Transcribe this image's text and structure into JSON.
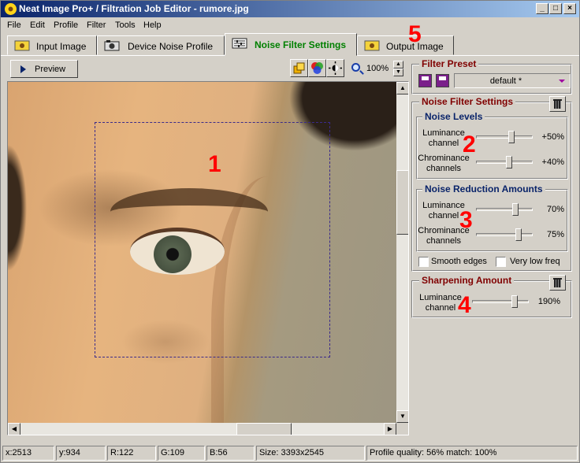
{
  "window": {
    "title": "Neat Image Pro+ / Filtration Job Editor - rumore.jpg"
  },
  "menu": [
    "File",
    "Edit",
    "Profile",
    "Filter",
    "Tools",
    "Help"
  ],
  "tabs": [
    {
      "label": "Input Image",
      "icon": "sunflower-image-icon"
    },
    {
      "label": "Device Noise Profile",
      "icon": "camera-icon"
    },
    {
      "label": "Noise Filter Settings",
      "icon": "sliders-icon",
      "active": true
    },
    {
      "label": "Output Image",
      "icon": "sunflower-image-icon"
    }
  ],
  "toolbar": {
    "preview_label": "Preview",
    "zoom": "100%"
  },
  "annotations": [
    "1",
    "2",
    "3",
    "4",
    "5"
  ],
  "filter_preset": {
    "title": "Filter Preset",
    "value": "default *"
  },
  "noise_filter_settings": {
    "title": "Noise Filter Settings",
    "noise_levels": {
      "title": "Noise Levels",
      "rows": [
        {
          "label": "Luminance channel",
          "value": "+50%",
          "level": 0.62
        },
        {
          "label": "Chrominance channels",
          "value": "+40%",
          "level": 0.58
        }
      ]
    },
    "noise_reduction": {
      "title": "Noise Reduction Amounts",
      "rows": [
        {
          "label": "Luminance channel",
          "value": "70%",
          "level": 0.7
        },
        {
          "label": "Chrominance channels",
          "value": "75%",
          "level": 0.75
        }
      ],
      "checkboxes": [
        {
          "label": "Smooth edges",
          "checked": false
        },
        {
          "label": "Very low freq",
          "checked": false
        }
      ]
    }
  },
  "sharpening": {
    "title": "Sharpening Amount",
    "rows": [
      {
        "label": "Luminance channel",
        "value": "190%",
        "level": 0.75
      }
    ]
  },
  "status": {
    "x": "x:2513",
    "y": "y:934",
    "r": "R:122",
    "g": "G:109",
    "b": "B:56",
    "size": "Size: 3393x2545",
    "profile": "Profile quality: 56%  match: 100%"
  },
  "colors": {
    "active_tab": "#008000",
    "section_title": "#800000",
    "subsection_title": "#0a246a",
    "annotation": "#ff0000"
  }
}
